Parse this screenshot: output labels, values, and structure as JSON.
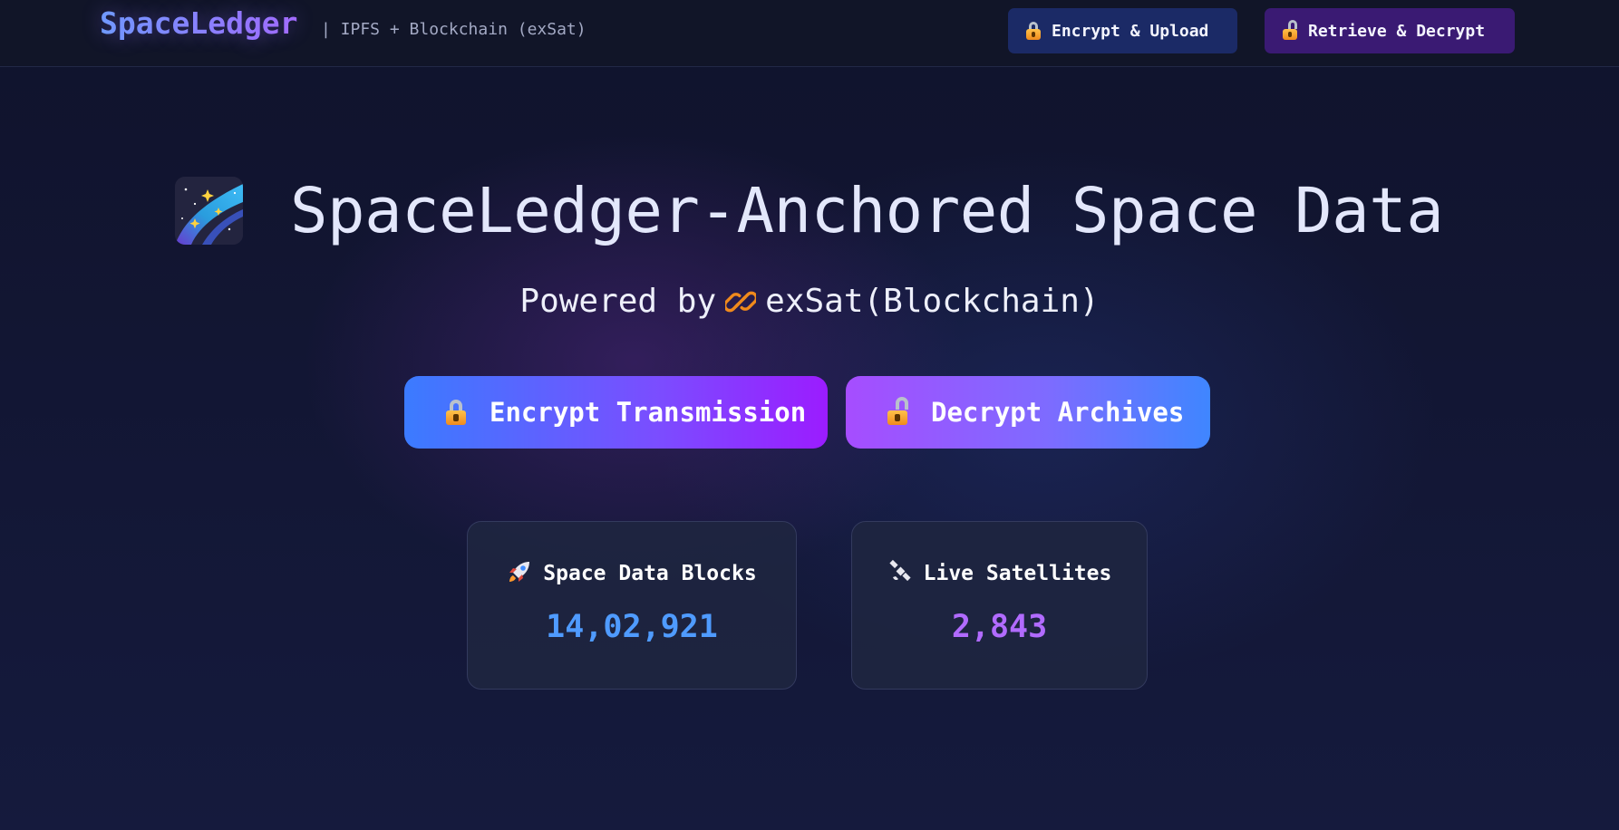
{
  "nav": {
    "brand": "SpaceLedger",
    "tagline": "| IPFS + Blockchain (exSat)",
    "buttons": [
      {
        "label": "Encrypt & Upload",
        "icon": "lock-icon"
      },
      {
        "label": "Retrieve & Decrypt",
        "icon": "unlock-icon"
      }
    ]
  },
  "hero": {
    "title": "SpaceLedger-Anchored Space Data",
    "powered_prefix": "Powered by",
    "powered_name": "exSat(Blockchain)",
    "powered_icon": "chain-link-icon",
    "buttons": [
      {
        "label": "Encrypt Transmission",
        "icon": "lock-icon"
      },
      {
        "label": "Decrypt Archives",
        "icon": "unlock-icon"
      }
    ]
  },
  "stats": [
    {
      "label": "Space Data Blocks",
      "value": "14,02,921",
      "icon": "rocket-icon",
      "color": "#4f9bff"
    },
    {
      "label": "Live Satellites",
      "value": "2,843",
      "icon": "satellite-icon",
      "color": "#b16bff"
    }
  ],
  "colors": {
    "background": "#121635",
    "navbar": "#111528",
    "upload_button": "#1b2a66",
    "retrieve_button": "#3a1a73",
    "exsat_orange": "#f08a1c"
  }
}
